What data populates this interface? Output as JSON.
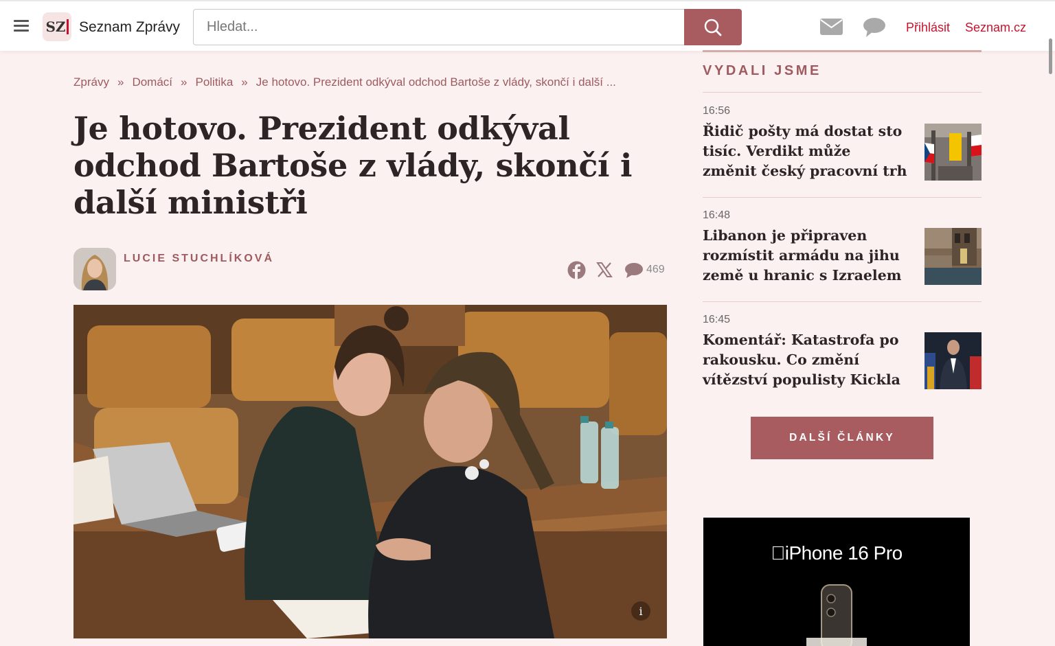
{
  "header": {
    "logo_mark": "SZ",
    "logo_text": "Seznam Zprávy",
    "search_placeholder": "Hledat...",
    "login_label": "Přihlásit",
    "portal_label": "Seznam.cz",
    "accent_color": "#a85c60",
    "link_color": "#c3152c"
  },
  "breadcrumb": {
    "items": [
      "Zprávy",
      "Domácí",
      "Politika"
    ],
    "current": "Je hotovo. Prezident odkýval odchod Bartoše z vlády, skončí i další ...",
    "separator": "»"
  },
  "article": {
    "title": "Je hotovo. Prezident odkýval odchod Bartoše z vlády, skončí i další ministři",
    "author": "LUCIE STUCHLÍKOVÁ",
    "comment_count": "469",
    "photo_info_glyph": "i"
  },
  "sidebar": {
    "heading": "VYDALI JSME",
    "items": [
      {
        "time": "16:56",
        "title": "Řidič pošty má dostat sto tisíc. Verdikt může změnit český pracovní trh"
      },
      {
        "time": "16:48",
        "title": "Libanon je připraven rozmístit armádu na jihu země u hranic s Izraelem"
      },
      {
        "time": "16:45",
        "title": "Komentář: Katastrofa po rakousku. Co změní vítězství populisty Kickla"
      }
    ],
    "more_button": "DALŠÍ ČLÁNKY"
  },
  "ad": {
    "text": "iPhone 16 Pro"
  }
}
